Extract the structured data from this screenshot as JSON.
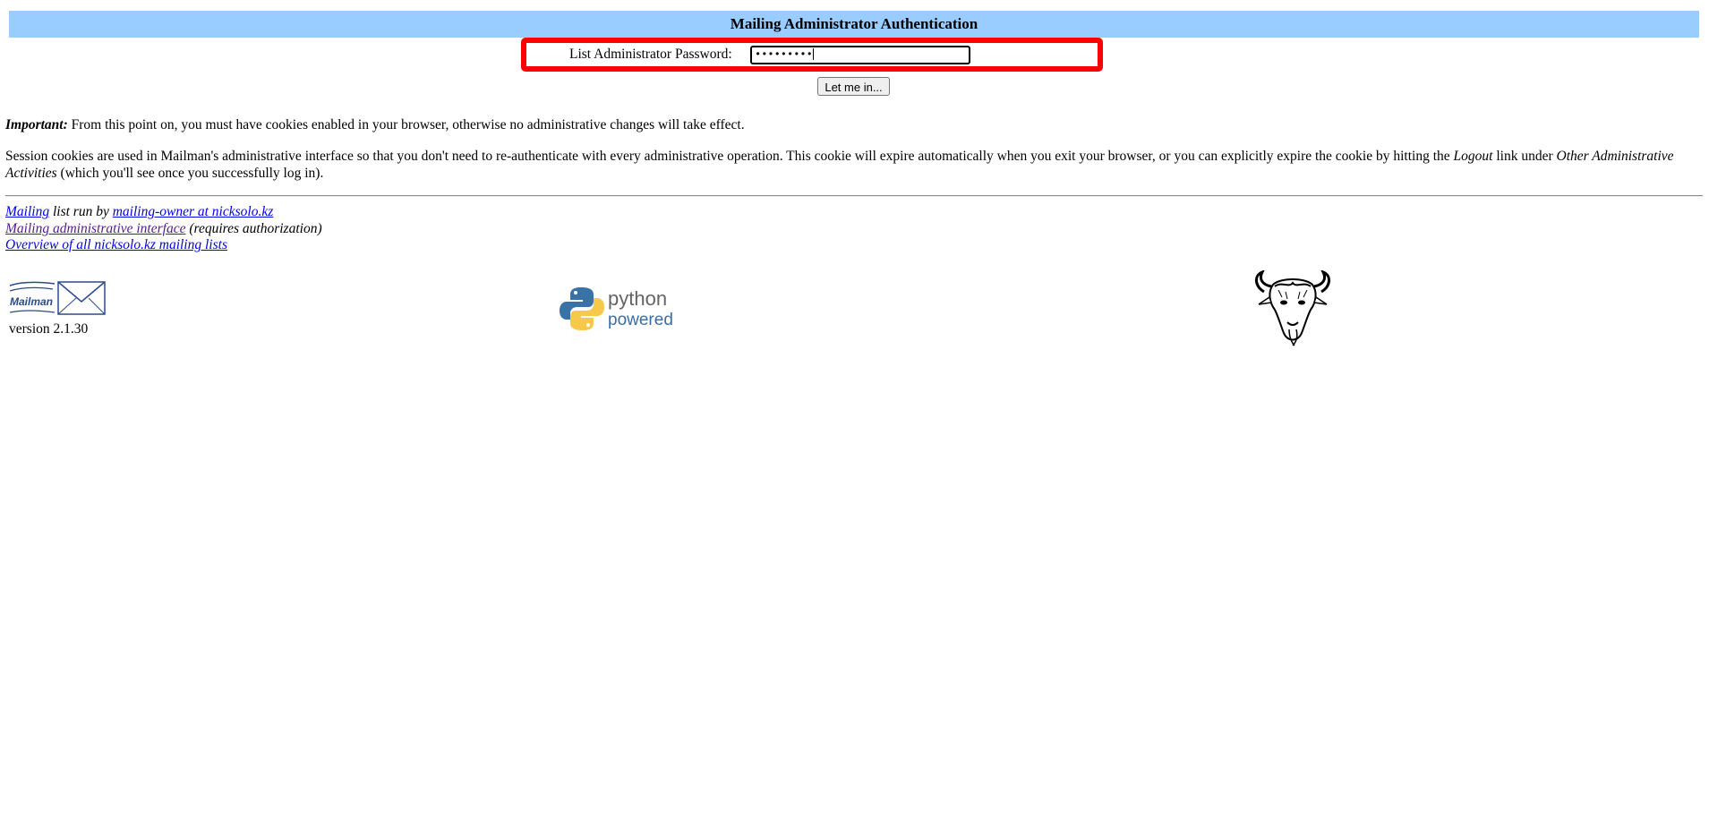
{
  "header": {
    "title": "Mailing Administrator Authentication"
  },
  "login": {
    "password_label": "List Administrator Password:",
    "password_value": "•••••••••",
    "submit_label": "Let me in..."
  },
  "notice": {
    "important_label": "Important:",
    "important_text": " From this point on, you must have cookies enabled in your browser, otherwise no administrative changes will take effect.",
    "session_text_1": "Session cookies are used in Mailman's administrative interface so that you don't need to re-authenticate with every administrative operation. This cookie will expire automatically when you exit your browser, or you can explicitly expire the cookie by hitting the ",
    "logout_term": "Logout",
    "session_text_2": " link under ",
    "other_activities_term": "Other Administrative Activities",
    "session_text_3": " (which you'll see once you successfully log in)."
  },
  "footer": {
    "list_link": "Mailing",
    "run_by_text": " list run by ",
    "owner_link": "mailing-owner at nicksolo.kz",
    "admin_link": "Mailing administrative interface",
    "admin_note": " (requires authorization)",
    "overview_link": "Overview of all nicksolo.kz mailing lists",
    "version": "version 2.1.30",
    "mailman_logo_text": "Mailman",
    "python_logo_word": "python",
    "python_logo_sub": "powered"
  },
  "colors": {
    "header_bg": "#99ccff",
    "highlight": "#ff0000",
    "link": "#0000ee",
    "visited": "#551a8b"
  },
  "icons": [
    "mailman-logo-icon",
    "python-logo-icon",
    "gnu-head-icon"
  ]
}
